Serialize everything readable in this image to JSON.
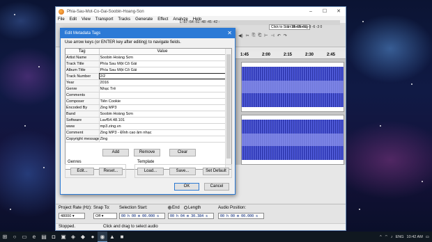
{
  "window": {
    "title": "Phia-Sau-Mot-Co-Gai-Soobin-Hoang-Son",
    "controls": [
      "–",
      "☐",
      "✕"
    ]
  },
  "menubar": [
    "File",
    "Edit",
    "View",
    "Transport",
    "Tracks",
    "Generate",
    "Effect",
    "Analyze",
    "Help"
  ],
  "toolbar": {
    "monitor_button": "Click to Start Monitoring",
    "meter_ticks": "1 -18 -15 -12 -9 -6 -3 0",
    "ruler_top": "L  -57 -54 -51 -48 -45 -42 -"
  },
  "timeline": {
    "ticks": [
      "1:45",
      "2:00",
      "2:15",
      "2:30",
      "2:45"
    ]
  },
  "dialog": {
    "title": "Edit Metadata Tags",
    "close": "✕",
    "hint": "Use arrow keys (or ENTER key after editing) to navigate fields.",
    "columns": {
      "tag": "Tag",
      "value": "Value"
    },
    "rows": [
      {
        "tag": "Artist Name",
        "value": "Soobin Hoàng Sơn"
      },
      {
        "tag": "Track Title",
        "value": "Phía Sau Một Cô Gái"
      },
      {
        "tag": "Album Title",
        "value": "Phía Sau Một Cô Gái"
      },
      {
        "tag": "Track Number",
        "value": "2/2"
      },
      {
        "tag": "Year",
        "value": "2016"
      },
      {
        "tag": "Genre",
        "value": "Nhạc Trẻ"
      },
      {
        "tag": "Comments",
        "value": ""
      },
      {
        "tag": "Composer",
        "value": "Tiên Cookie"
      },
      {
        "tag": "Encoded By",
        "value": "Zing MP3"
      },
      {
        "tag": "Band",
        "value": "Soobin Hoàng Sơn"
      },
      {
        "tag": "Software",
        "value": "Lavf54.48.101"
      },
      {
        "tag": "www",
        "value": "mp3.zing.vn"
      },
      {
        "tag": "Comment",
        "value": "Zing MP3 - Đỉnh cao âm nhạc"
      },
      {
        "tag": "Copyright message",
        "value": "Zing"
      }
    ],
    "buttons": {
      "add": "Add",
      "remove": "Remove",
      "clear": "Clear",
      "genres_label": "Genres",
      "genres_edit": "Edit...",
      "genres_reset": "Reset...",
      "template_label": "Template",
      "template_load": "Load...",
      "template_save": "Save...",
      "template_default": "Set Default",
      "ok": "OK",
      "cancel": "Cancel"
    }
  },
  "selection_bar": {
    "project_rate_label": "Project Rate (Hz):",
    "project_rate_value": "48000",
    "snap_to_label": "Snap To:",
    "snap_to_value": "Off",
    "selection_start_label": "Selection Start:",
    "selection_start_value": "00 h 00 m 00.000 s",
    "end_label": "End",
    "length_label": "Length",
    "end_value": "00 h 04 m 30.384 s",
    "audio_position_label": "Audio Position:",
    "audio_position_value": "00 h 00 m 00.000 s"
  },
  "status": {
    "left": "Stopped.",
    "right": "Click and drag to select audio"
  },
  "taskbar": {
    "language": "ENG",
    "time": "10:42 AM"
  }
}
